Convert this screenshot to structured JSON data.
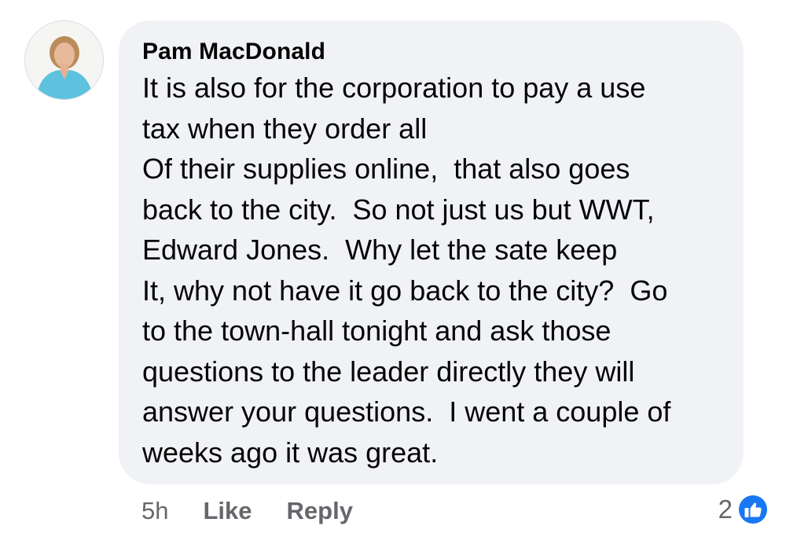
{
  "comment": {
    "author": "Pam MacDonald",
    "lines": [
      "It is also for the corporation to pay a use",
      "tax when they order all",
      "Of their supplies online,  that also goes",
      "back to the city.  So not just us but WWT,",
      "Edward Jones.  Why let the sate keep",
      "It, why not have it go back to the city?  Go",
      "to the town-hall tonight and ask those",
      "questions to the leader directly they will",
      "answer your questions.  I went a couple of",
      "weeks ago it was great."
    ]
  },
  "actions": {
    "time": "5h",
    "like_label": "Like",
    "reply_label": "Reply"
  },
  "reactions": {
    "count": "2",
    "icon": "thumbs-up-icon",
    "color": "#1877f2"
  },
  "colors": {
    "bubble": "#f0f2f5",
    "text": "#050505",
    "secondary": "#65676b"
  }
}
